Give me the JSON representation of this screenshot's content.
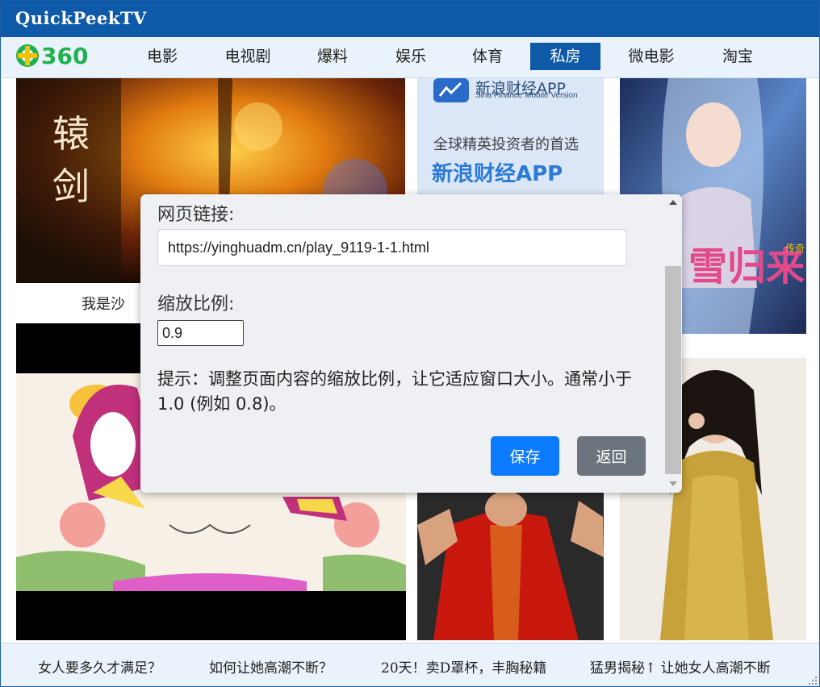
{
  "app": {
    "title": "QuickPeekTV"
  },
  "logo": {
    "text": "360",
    "color": "#1fb14d"
  },
  "nav": {
    "items": [
      {
        "label": "电影"
      },
      {
        "label": "电视剧"
      },
      {
        "label": "爆料"
      },
      {
        "label": "娱乐"
      },
      {
        "label": "体育"
      },
      {
        "label": "私房",
        "active": true
      },
      {
        "label": "微电影"
      },
      {
        "label": "淘宝"
      }
    ]
  },
  "content": {
    "tiles": {
      "sword_caption": "我是沙",
      "finance": {
        "brand": "新浪财经APP",
        "sub": "Sina Finance Mobile Version",
        "slogan": "全球精英投资者的首选",
        "big": "新浪财经APP"
      },
      "anime_title": "雪归来",
      "anime_tag": "传奇"
    }
  },
  "dialog": {
    "url_label": "网页链接:",
    "url_value": "https://yinghuadm.cn/play_9119-1-1.html",
    "scale_label": "缩放比例:",
    "scale_value": "0.9",
    "hint": "提示：调整页面内容的缩放比例，让它适应窗口大小。通常小于 1.0 (例如 0.8)。",
    "save_label": "保存",
    "back_label": "返回"
  },
  "footer": {
    "links": [
      {
        "label": "女人要多久才满足？"
      },
      {
        "label": "如何让她高潮不断？"
      },
      {
        "label": "20天！卖D罩杯，丰胸秘籍"
      },
      {
        "label": "猛男揭秘↑ 让她女人高潮不断"
      }
    ]
  },
  "colors": {
    "titlebar": "#0e59a8",
    "nav_active": "#0e59a8",
    "save_button": "#0d7bff",
    "back_button": "#6c757d"
  }
}
